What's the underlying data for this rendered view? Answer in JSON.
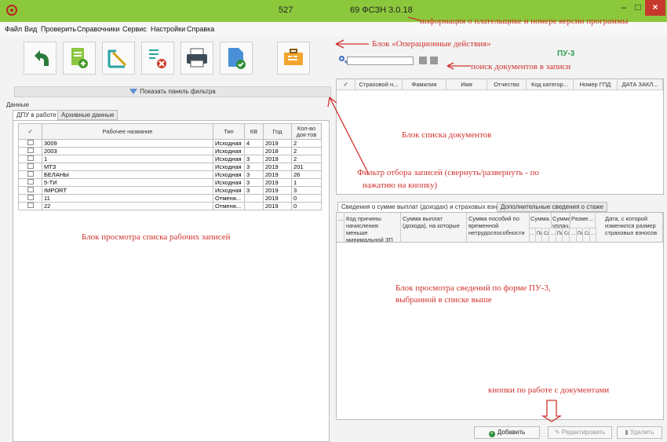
{
  "window": {
    "title_number": "527",
    "title_version": "69 ФСЗН 3.0.18",
    "min_glyph": "–",
    "max_glyph": "□",
    "close_glyph": "×"
  },
  "menu": [
    "Файл",
    "Вид",
    "Проверить",
    "Справочники",
    "Сервис",
    "Настройки",
    "Справка"
  ],
  "toolbar": {
    "icons": [
      "undo-icon",
      "add-document-icon",
      "edit-document-icon",
      "delete-document-icon",
      "print-icon",
      "check-document-icon",
      "briefcase-icon"
    ]
  },
  "filter": {
    "toggle_label": "Показать панель фильтра"
  },
  "data_label": "Данные",
  "left_tabs": [
    "ДПУ в работе",
    "Архивные данные"
  ],
  "work_table": {
    "headers": [
      "✓",
      "Рабочее название",
      "Тип",
      "КВ",
      "Год",
      "Кол-во док-тов"
    ],
    "rows": [
      [
        "3009",
        "Исходная",
        "4",
        "2019",
        "2"
      ],
      [
        "2003",
        "Исходная",
        "",
        "2018",
        "2"
      ],
      [
        "1",
        "Исходная",
        "3",
        "2019",
        "2"
      ],
      [
        "МТЗ",
        "Исходная",
        "3",
        "2019",
        "201"
      ],
      [
        "БЕЛАНЫ",
        "Исходная",
        "3",
        "2019",
        "26"
      ],
      [
        "5-ТИ",
        "Исходная",
        "3",
        "2019",
        "1"
      ],
      [
        "IMPORT",
        "Исходная",
        "3",
        "2019",
        "3"
      ],
      [
        "11",
        "Отменя...",
        "",
        "2019",
        "0"
      ],
      [
        "22",
        "Отменя...",
        "",
        "2019",
        "0"
      ]
    ]
  },
  "right_panel": {
    "pu3_label": "ПУ-3",
    "doc_headers": [
      "✓",
      "Страховой н...",
      "Фамилия",
      "Имя",
      "Отчество",
      "Код категор...",
      "Номер ГПД",
      "ДАТА ЗАКЛ..."
    ],
    "tabs": [
      "Сведения о сумме выплат (доходах) и страховых взносах",
      "Дополнительные сведения о стаже"
    ],
    "detail_headers": {
      "col_dots": "...",
      "col1": "Код причины начисления меньше минимальной ЗП",
      "col2": "Сумма выплат (дохода), на которые",
      "col3": "Сумма пособий по временной нетрудоспособности",
      "col4": "Сумма...",
      "col5": "Сумма уплач...",
      "col6": "Разме...",
      "col7": "Дата, с которой изменился размер страховых взносов"
    },
    "sub_headers": [
      "...",
      "Пе",
      "Со",
      "...",
      "Пе",
      "Со",
      "...",
      "Пе",
      "Со",
      "..."
    ],
    "buttons": {
      "add": "Добавить",
      "edit": "Редактировать",
      "delete": "Удалить"
    }
  },
  "annotations": {
    "version_info": "информация о плательщике и номере версии программы",
    "ops_block": "Блок «Операционные действия»",
    "search": "поиск документов в записи",
    "doc_list": "Блок списка документов",
    "filter_line1": "Фильтр отбора записей (свернуть/развернуть - по",
    "filter_line2": "нажатию на кнопку)",
    "work_list": "Блок просмотра списка рабочих записей",
    "detail_line1": "Блок просмотра сведений по форме ПУ-3,",
    "detail_line2": "выбранной в списке выше",
    "buttons_note": "кнопки по работе с документами"
  },
  "colors": {
    "title_bar": "#8cc83c",
    "annotation": "#d0312d",
    "pu3": "#2aa04a",
    "close_button": "#c7382c"
  }
}
